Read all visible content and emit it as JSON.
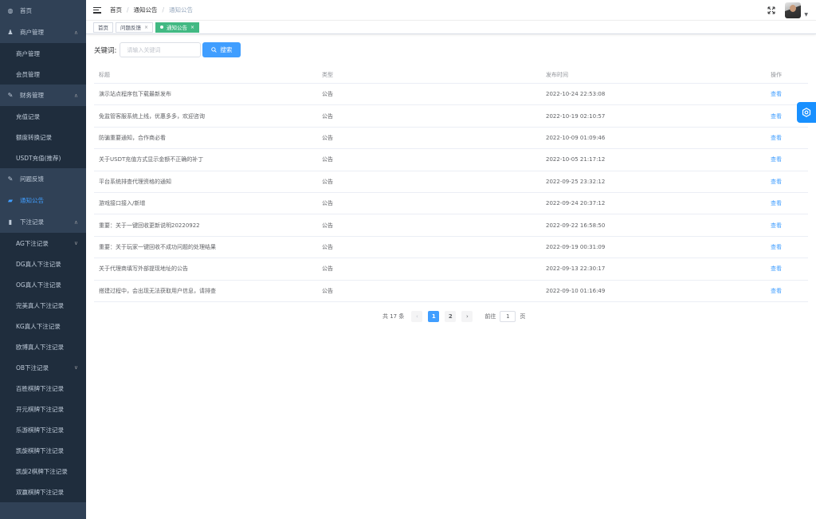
{
  "sidebar": {
    "items": [
      {
        "label": "首页",
        "icon": "dashboard-icon",
        "level": "top"
      },
      {
        "label": "商户管理",
        "icon": "users-icon",
        "level": "top",
        "arrow": "∧"
      },
      {
        "label": "商户管理",
        "level": "sub"
      },
      {
        "label": "会员管理",
        "level": "sub"
      },
      {
        "label": "财务管理",
        "icon": "edit-icon",
        "level": "top",
        "arrow": "∧"
      },
      {
        "label": "充值记录",
        "level": "sub"
      },
      {
        "label": "额度转换记录",
        "level": "sub"
      },
      {
        "label": "USDT充值(推荐)",
        "level": "sub"
      },
      {
        "label": "问题反馈",
        "icon": "feedback-icon",
        "level": "top"
      },
      {
        "label": "通知公告",
        "icon": "folder-icon",
        "level": "top",
        "active": true
      },
      {
        "label": "下注记录",
        "icon": "document-icon",
        "level": "top",
        "arrow": "∧"
      },
      {
        "label": "AG下注记录",
        "level": "sub",
        "arrow": "∨"
      },
      {
        "label": "DG真人下注记录",
        "level": "sub"
      },
      {
        "label": "OG真人下注记录",
        "level": "sub"
      },
      {
        "label": "完美真人下注记录",
        "level": "sub"
      },
      {
        "label": "KG真人下注记录",
        "level": "sub"
      },
      {
        "label": "欧博真人下注记录",
        "level": "sub"
      },
      {
        "label": "OB下注记录",
        "level": "sub",
        "arrow": "∨"
      },
      {
        "label": "百胜棋牌下注记录",
        "level": "sub"
      },
      {
        "label": "开元棋牌下注记录",
        "level": "sub"
      },
      {
        "label": "乐游棋牌下注记录",
        "level": "sub"
      },
      {
        "label": "凯旋棋牌下注记录",
        "level": "sub"
      },
      {
        "label": "凯旋2棋牌下注记录",
        "level": "sub"
      },
      {
        "label": "双赢棋牌下注记录",
        "level": "sub"
      }
    ]
  },
  "header": {
    "breadcrumb": [
      "首页",
      "通知公告",
      "通知公告"
    ]
  },
  "tags": [
    {
      "label": "首页",
      "closable": false,
      "active": false
    },
    {
      "label": "问题反馈",
      "closable": true,
      "active": false
    },
    {
      "label": "通知公告",
      "closable": true,
      "active": true
    }
  ],
  "search": {
    "label": "关键词:",
    "placeholder": "请输入关键词",
    "button_label": "搜索"
  },
  "table": {
    "columns": [
      "标题",
      "类型",
      "发布时间",
      "操作"
    ],
    "rows": [
      {
        "title": "演示站点程序包下载最新发布",
        "type": "公告",
        "time": "2022-10-24 22:53:08",
        "action": "查看"
      },
      {
        "title": "免监管客服系统上线，优惠多多，欢迎咨询",
        "type": "公告",
        "time": "2022-10-19 02:10:57",
        "action": "查看"
      },
      {
        "title": "防骗重要通知，合作商必看",
        "type": "公告",
        "time": "2022-10-09 01:09:46",
        "action": "查看"
      },
      {
        "title": "关于USDT充值方式显示金额不正确的补丁",
        "type": "公告",
        "time": "2022-10-05 21:17:12",
        "action": "查看"
      },
      {
        "title": "平台系统排查代理资格的通知",
        "type": "公告",
        "time": "2022-09-25 23:32:12",
        "action": "查看"
      },
      {
        "title": "游戏接口接入/新增",
        "type": "公告",
        "time": "2022-09-24 20:37:12",
        "action": "查看"
      },
      {
        "title": "重要：关于一键回收更新说明20220922",
        "type": "公告",
        "time": "2022-09-22 16:58:50",
        "action": "查看"
      },
      {
        "title": "重要：关于玩家一键回收不成功问题的处理结果",
        "type": "公告",
        "time": "2022-09-19 00:31:09",
        "action": "查看"
      },
      {
        "title": "关于代理商填写外部提现地址的公告",
        "type": "公告",
        "time": "2022-09-13 22:30:17",
        "action": "查看"
      },
      {
        "title": "搭建过程中，会出现无法获取用户信息，请排查",
        "type": "公告",
        "time": "2022-09-10 01:16:49",
        "action": "查看"
      }
    ]
  },
  "pagination": {
    "total_text": "共 17 条",
    "pages": [
      "1",
      "2"
    ],
    "current": "1",
    "goto_label": "前往",
    "goto_value": "1",
    "page_unit": "页"
  },
  "colors": {
    "sidebar_bg": "#304156",
    "submenu_bg": "#1f2d3d",
    "primary": "#409eff",
    "tag_active": "#42b983"
  }
}
